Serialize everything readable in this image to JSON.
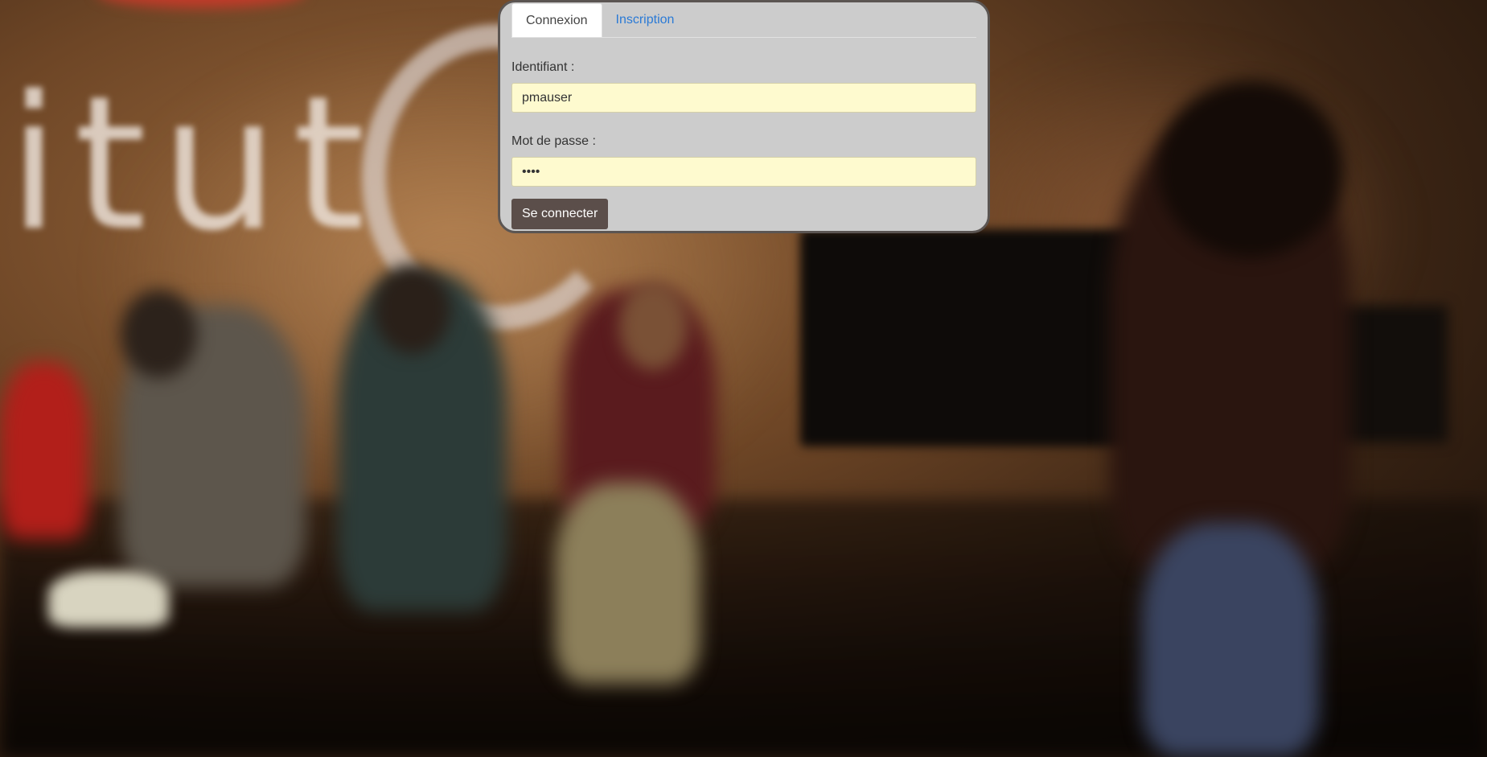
{
  "login": {
    "tabs": [
      {
        "label": "Connexion",
        "active": true
      },
      {
        "label": "Inscription",
        "active": false
      }
    ],
    "username_label": "Identifiant :",
    "username_value": "pmauser",
    "password_label": "Mot de passe :",
    "password_value": "••••",
    "submit_label": "Se connecter"
  },
  "background": {
    "signage_text": "itut"
  },
  "colors": {
    "panel_bg": "#cccccc",
    "panel_border": "#5b5552",
    "input_bg": "#fefacf",
    "tab_link": "#2a7ad6",
    "button_bg": "#5b4e4a"
  }
}
